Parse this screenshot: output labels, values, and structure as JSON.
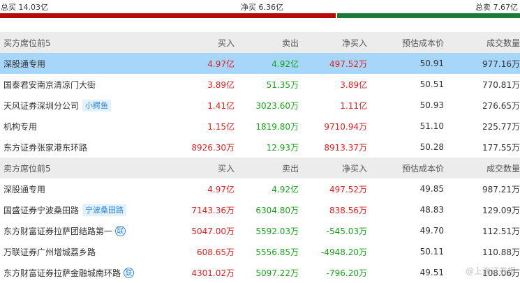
{
  "summary": {
    "total_buy": "总买 14.03亿",
    "net_buy": "净买 6.36亿",
    "total_sell": "总卖 7.67亿",
    "buy_ratio": 0.645
  },
  "colors": {
    "buy_bar": "#b80b0b",
    "sell_bar": "#1b7a35",
    "highlight": "#a6d6f9",
    "red": "#e51e1e",
    "green": "#18a31a",
    "tag": "#2a87d8"
  },
  "buy_section": {
    "headers": [
      "买方席位前5",
      "买入",
      "卖出",
      "净买入",
      "预估成本价",
      "成交数量"
    ],
    "rows": [
      {
        "seat": "深股通专用",
        "tag": "",
        "buy": "4.97亿",
        "sell": "4.92亿",
        "net": "497.52万",
        "cost": "50.91",
        "volume": "977.16万"
      },
      {
        "seat": "国泰君安南京清凉门大街",
        "tag": "",
        "buy": "3.89亿",
        "sell": "51.35万",
        "net": "3.89亿",
        "cost": "50.51",
        "volume": "770.81万"
      },
      {
        "seat": "天风证券深圳分公司",
        "tag": "小鳄鱼",
        "buy": "1.41亿",
        "sell": "3023.60万",
        "net": "1.11亿",
        "cost": "50.93",
        "volume": "276.65万"
      },
      {
        "seat": "机构专用",
        "tag": "",
        "buy": "1.15亿",
        "sell": "1819.80万",
        "net": "9710.94万",
        "cost": "51.10",
        "volume": "225.77万"
      },
      {
        "seat": "东方证券张家港东环路",
        "tag": "",
        "buy": "8926.30万",
        "sell": "12.93万",
        "net": "8913.37万",
        "cost": "50.28",
        "volume": "177.55万"
      }
    ]
  },
  "sell_section": {
    "headers": [
      "卖方席位前5",
      "买入",
      "卖出",
      "净买入",
      "预估成本价",
      "成交数量"
    ],
    "rows": [
      {
        "seat": "深股通专用",
        "tag": "",
        "badge": "",
        "buy": "4.97亿",
        "sell": "4.92亿",
        "net": "497.52万",
        "cost": "49.85",
        "volume": "987.21万"
      },
      {
        "seat": "国盛证券宁波桑田路",
        "tag": "宁波桑田路",
        "badge": "",
        "buy": "7143.36万",
        "sell": "6304.80万",
        "net": "838.56万",
        "cost": "48.83",
        "volume": "129.09万"
      },
      {
        "seat": "东方财富证券拉萨团结路第一",
        "tag": "",
        "badge": "联",
        "buy": "5047.00万",
        "sell": "5592.03万",
        "net": "-545.03万",
        "cost": "49.70",
        "volume": "112.51万"
      },
      {
        "seat": "万联证券广州增城荔乡路",
        "tag": "",
        "badge": "",
        "buy": "608.65万",
        "sell": "5556.85万",
        "net": "-4948.20万",
        "cost": "50.11",
        "volume": "110.88万"
      },
      {
        "seat": "东方财富证券拉萨金融城南环路",
        "tag": "",
        "badge": "联",
        "buy": "4301.02万",
        "sell": "5097.22万",
        "net": "-796.20万",
        "cost": "49.51",
        "volume": "108.06万"
      }
    ]
  },
  "watermark": "@上海证券报"
}
